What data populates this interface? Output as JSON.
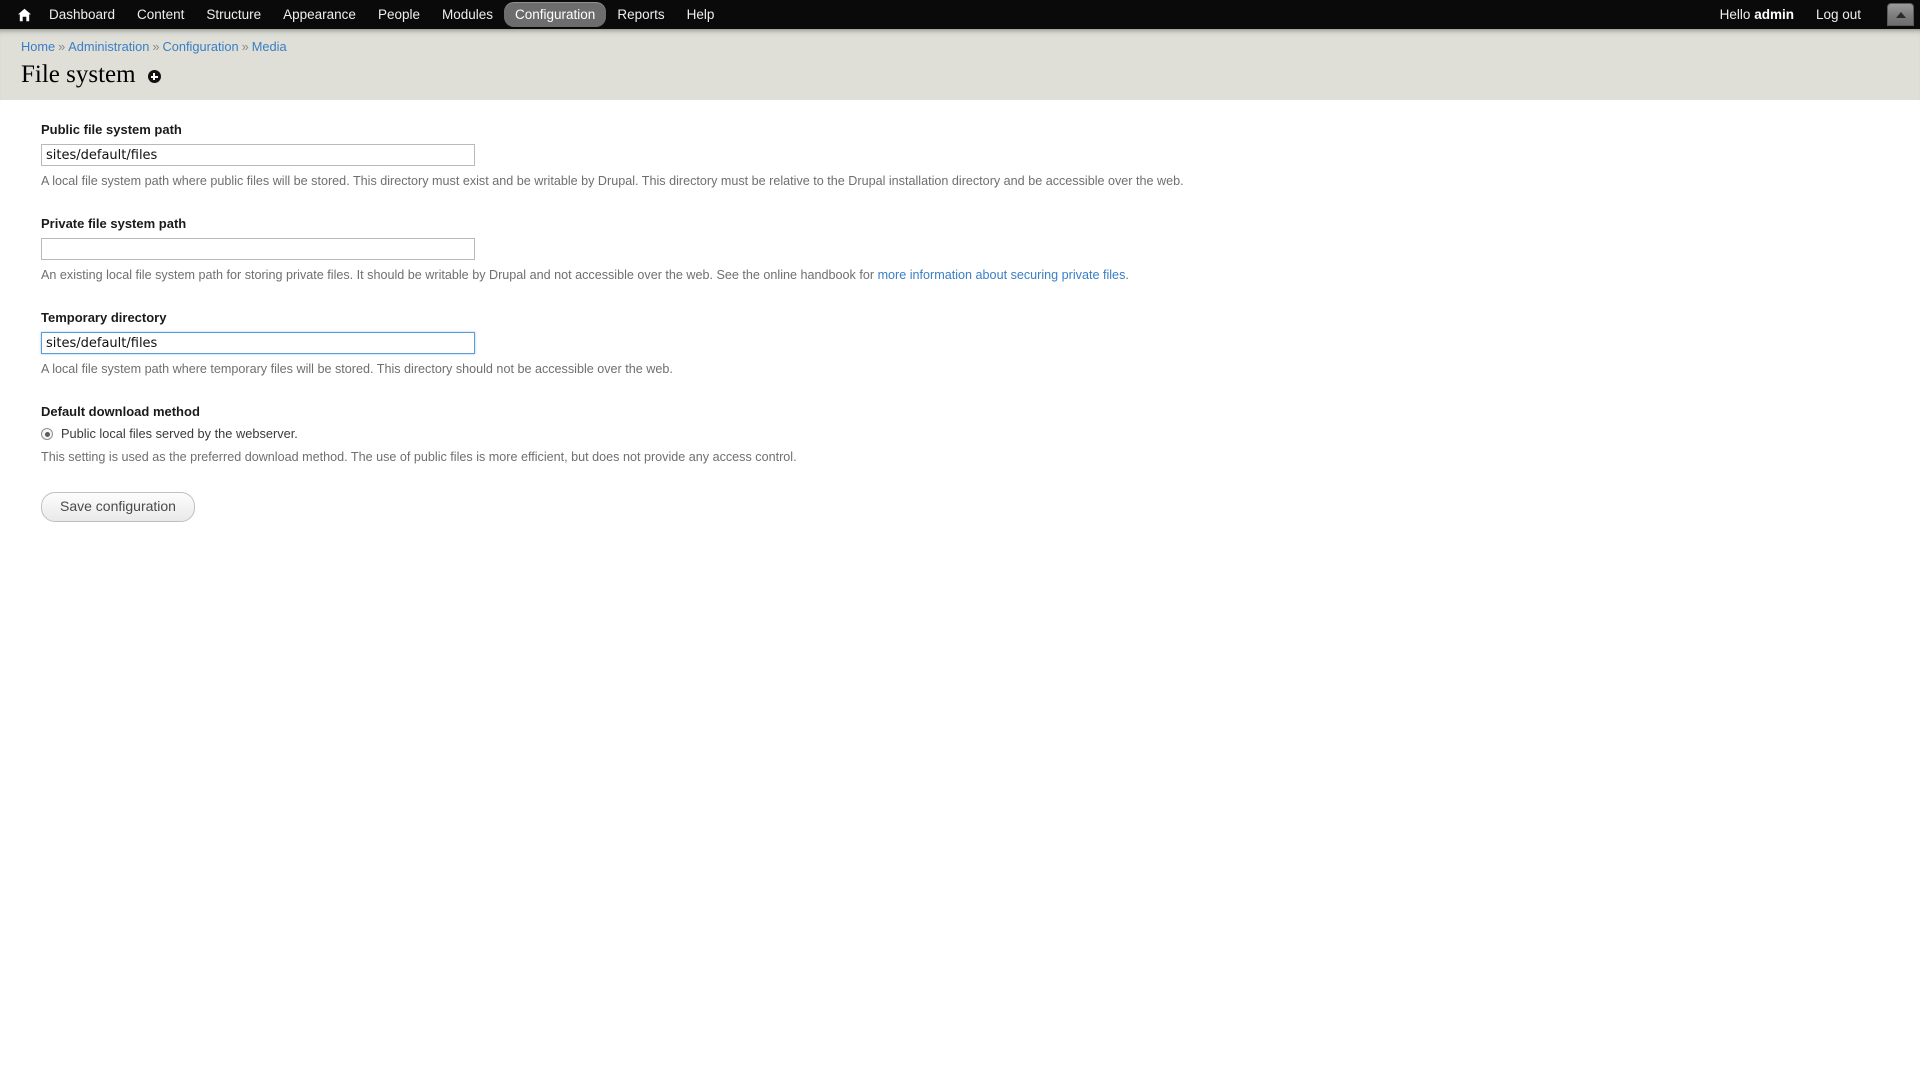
{
  "toolbar": {
    "home_title": "Home",
    "items": [
      {
        "label": "Dashboard",
        "active": false
      },
      {
        "label": "Content",
        "active": false
      },
      {
        "label": "Structure",
        "active": false
      },
      {
        "label": "Appearance",
        "active": false
      },
      {
        "label": "People",
        "active": false
      },
      {
        "label": "Modules",
        "active": false
      },
      {
        "label": "Configuration",
        "active": true
      },
      {
        "label": "Reports",
        "active": false
      },
      {
        "label": "Help",
        "active": false
      }
    ],
    "greeting_prefix": "Hello ",
    "username": "admin",
    "logout_label": "Log out",
    "toggle_label": "Collapse toolbar",
    "active_color": "#6d6d6d",
    "background_color": "#0a0a0a"
  },
  "breadcrumb": {
    "items": [
      "Home",
      "Administration",
      "Configuration",
      "Media"
    ],
    "separator": "»",
    "link_color": "#3a7ec4"
  },
  "page": {
    "title": "File system",
    "contextual_icon": "add-circle-icon",
    "band_color": "#dfdfd8"
  },
  "form": {
    "public_path": {
      "label": "Public file system path",
      "value": "sites/default/files",
      "placeholder": "",
      "description": "A local file system path where public files will be stored. This directory must exist and be writable by Drupal. This directory must be relative to the Drupal installation directory and be accessible over the web."
    },
    "private_path": {
      "label": "Private file system path",
      "value": "",
      "placeholder": "",
      "description_before": "An existing local file system path for storing private files. It should be writable by Drupal and not accessible over the web. See the online handbook for ",
      "description_link": "more information about securing private files",
      "description_after": "."
    },
    "temporary_directory": {
      "label": "Temporary directory",
      "value": "sites/default/files",
      "placeholder": "",
      "focused": true,
      "description": "A local file system path where temporary files will be stored. This directory should not be accessible over the web."
    },
    "download_method": {
      "label": "Default download method",
      "options": [
        {
          "label": "Public local files served by the webserver.",
          "selected": true
        }
      ],
      "description": "This setting is used as the preferred download method. The use of public files is more efficient, but does not provide any access control."
    },
    "submit": {
      "label": "Save configuration"
    }
  }
}
